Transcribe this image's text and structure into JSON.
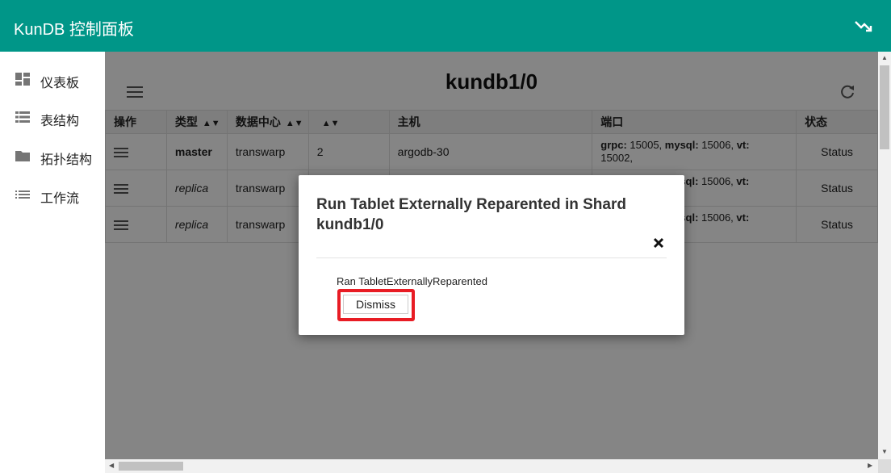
{
  "app": {
    "title": "KunDB 控制面板",
    "accent": "#009688"
  },
  "sidebar": {
    "items": [
      {
        "label": "仪表板",
        "icon": "dashboard-icon"
      },
      {
        "label": "表结构",
        "icon": "list-icon"
      },
      {
        "label": "拓扑结构",
        "icon": "folder-icon"
      },
      {
        "label": "工作流",
        "icon": "list-bullet-icon"
      }
    ]
  },
  "page": {
    "title": "kundb1/0"
  },
  "table": {
    "headers": [
      "操作",
      "类型",
      "数据中心",
      "",
      "主机",
      "端口",
      "状态"
    ],
    "rows": [
      {
        "type": "master",
        "cell": "transwarp",
        "uid": "2",
        "host": "argodb-30",
        "port_html_label_a": "grpc:",
        "port_a": " 15005, ",
        "port_html_label_b": "mysql:",
        "port_b": " 15006, ",
        "port_html_label_c": "vt:",
        "port_c": " 15002,",
        "status": "Status"
      },
      {
        "type": "replica",
        "cell": "transwarp",
        "uid": "",
        "host": "",
        "port_html_label_a": "",
        "port_a": "",
        "port_html_label_b": "sql:",
        "port_b": " 15006, ",
        "port_html_label_c": "vt:",
        "port_c": "",
        "status": "Status"
      },
      {
        "type": "replica",
        "cell": "transwarp",
        "uid": "",
        "host": "",
        "port_html_label_a": "",
        "port_a": "",
        "port_html_label_b": "sql:",
        "port_b": " 15006, ",
        "port_html_label_c": "vt:",
        "port_c": "",
        "status": "Status"
      }
    ]
  },
  "dialog": {
    "title": "Run Tablet Externally Reparented in Shard kundb1/0",
    "message": "Ran TabletExternallyReparented",
    "dismiss_label": "Dismiss",
    "highlight_color": "#e81c24"
  }
}
